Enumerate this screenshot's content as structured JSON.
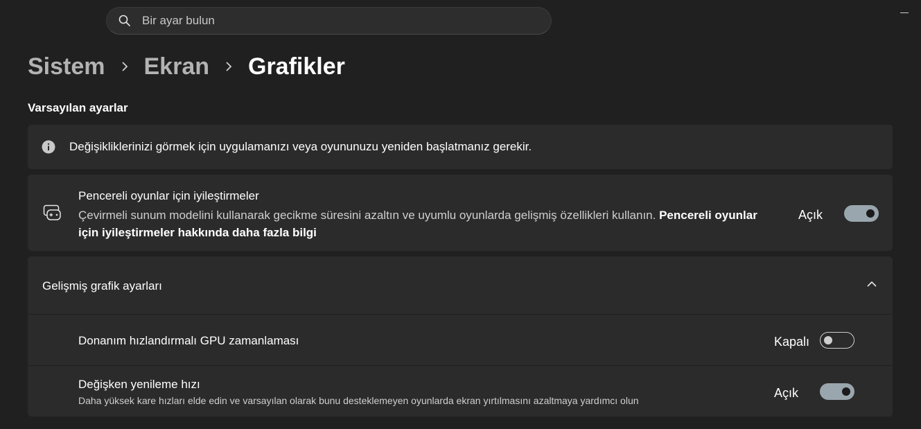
{
  "search": {
    "placeholder": "Bir ayar bulun",
    "icon": "search-icon"
  },
  "breadcrumb": {
    "items": [
      "Sistem",
      "Ekran",
      "Grafikler"
    ]
  },
  "section_title": "Varsayılan ayarlar",
  "info": {
    "text": "Değişikliklerinizi görmek için uygulamanızı veya oyununuzu yeniden başlatmanız gerekir."
  },
  "windowed": {
    "title": "Pencereli oyunlar için iyileştirmeler",
    "description": "Çevirmeli sunum modelini kullanarak gecikme süresini azaltın ve uyumlu oyunlarda gelişmiş özellikleri kullanın.",
    "link": "Pencereli oyunlar için iyileştirmeler hakkında daha fazla bilgi",
    "state": "Açık",
    "on": true
  },
  "advanced": {
    "title": "Gelişmiş grafik ayarları",
    "expanded": true,
    "rows": [
      {
        "title": "Donanım hızlandırmalı GPU zamanlaması",
        "subtitle": "",
        "state": "Kapalı",
        "on": false
      },
      {
        "title": "Değişken yenileme hızı",
        "subtitle": "Daha yüksek kare hızları elde edin ve varsayılan olarak bunu desteklemeyen oyunlarda ekran yırtılmasını azaltmaya yardımcı olun",
        "state": "Açık",
        "on": true
      }
    ]
  },
  "colors": {
    "background": "#202020",
    "card": "#2b2b2b",
    "toggle_on": "#9aa6ad"
  }
}
